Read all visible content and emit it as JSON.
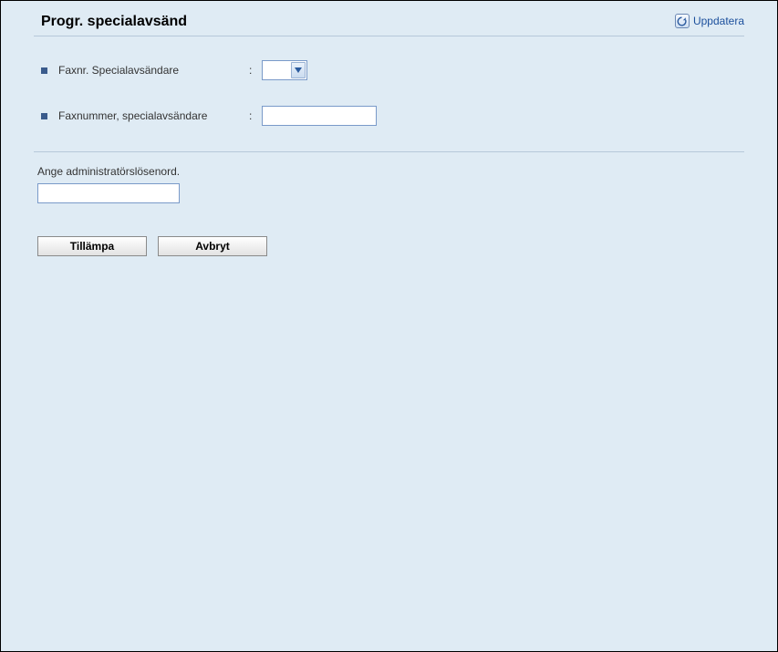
{
  "header": {
    "title": "Progr. specialavsänd",
    "refresh_label": "Uppdatera"
  },
  "form": {
    "row1": {
      "label": "Faxnr. Specialavsändare",
      "colon": ":",
      "selected": ""
    },
    "row2": {
      "label": "Faxnummer, specialavsändare",
      "colon": ":",
      "value": ""
    }
  },
  "password_section": {
    "prompt": "Ange administratörslösenord.",
    "value": ""
  },
  "buttons": {
    "apply": "Tillämpa",
    "cancel": "Avbryt"
  }
}
